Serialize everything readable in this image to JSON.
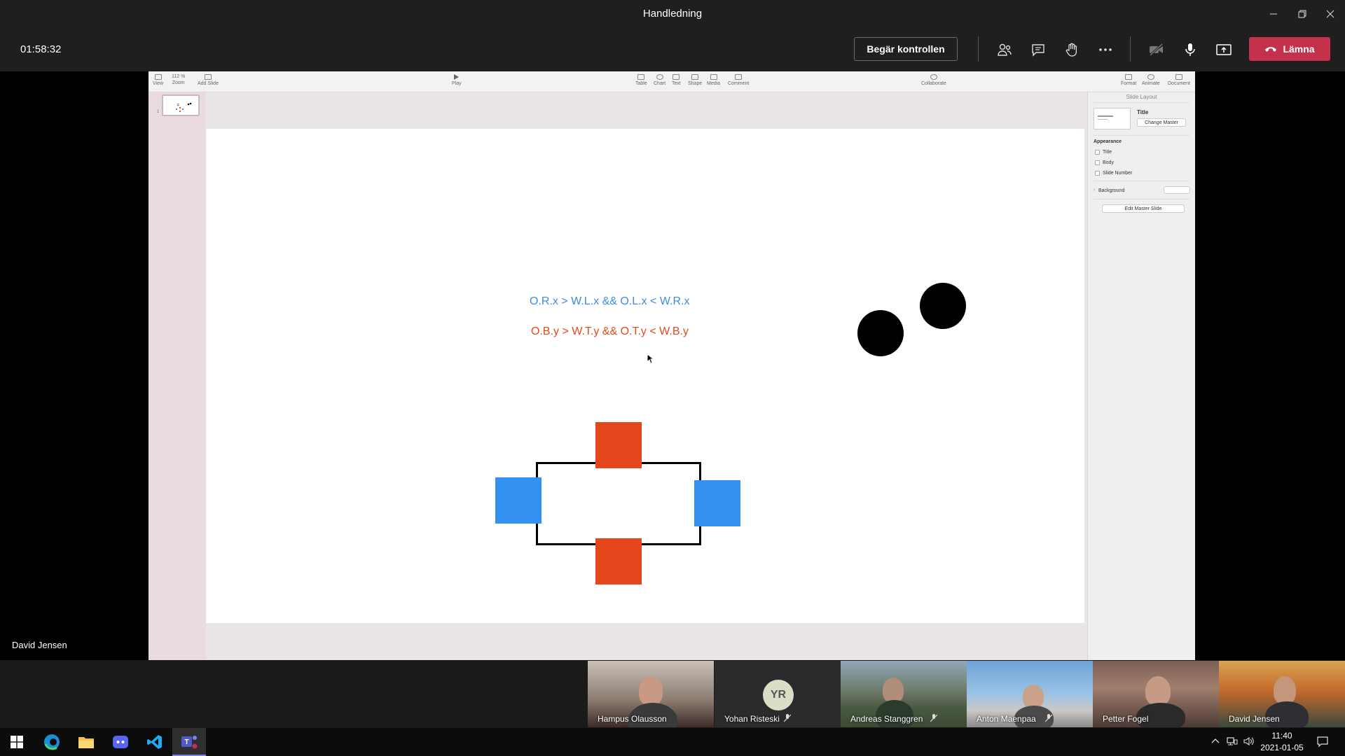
{
  "window": {
    "title": "Handledning",
    "controls": [
      "minimize-icon",
      "restore-icon",
      "close-icon"
    ]
  },
  "meeting_toolbar": {
    "duration": "01:58:32",
    "request_control_label": "Begär kontrollen",
    "icons": [
      "participants-icon",
      "chat-icon",
      "raise-hand-icon",
      "more-icon",
      "camera-off-icon",
      "microphone-icon",
      "share-screen-icon"
    ],
    "leave_label": "Lämna",
    "leave_color": "#c4314b"
  },
  "keynote": {
    "toolbar": {
      "zoom_value": "112 %",
      "items_left": [
        "View",
        "Zoom",
        "Add Slide"
      ],
      "play_label": "Play",
      "items_insert": [
        "Table",
        "Chart",
        "Text",
        "Shape",
        "Media",
        "Comment"
      ],
      "collaborate_label": "Collaborate",
      "items_right": [
        "Format",
        "Animate",
        "Document"
      ]
    },
    "slide_number": "1",
    "slide": {
      "formula_x": "O.R.x > W.L.x && O.L.x < W.R.x",
      "formula_y": "O.B.y > W.T.y && O.T.y < W.B.y",
      "formula_x_color": "#3a8ee6",
      "formula_y_color": "#e04a1c",
      "red_color": "#e5461b",
      "blue_color": "#3391f0"
    },
    "inspector": {
      "header": "Slide Layout",
      "layout_name": "Title",
      "change_master_label": "Change Master",
      "appearance_label": "Appearance",
      "options": [
        "Title",
        "Body",
        "Slide Number"
      ],
      "background_label": "Background",
      "edit_master_label": "Edit Master Slide"
    }
  },
  "presenter_name": "David Jensen",
  "participants": [
    {
      "name": "Hampus Olausson",
      "muted": false
    },
    {
      "name": "Yohan Risteski",
      "initials": "YR",
      "muted": true
    },
    {
      "name": "Andreas Stanggren",
      "muted": true
    },
    {
      "name": "Anton Maenpaa",
      "muted": true
    },
    {
      "name": "Petter Fogel",
      "muted": false
    },
    {
      "name": "David Jensen",
      "muted": false
    }
  ],
  "taskbar": {
    "apps": [
      "windows-start-icon",
      "edge-icon",
      "file-explorer-icon",
      "discord-icon",
      "vscode-icon",
      "teams-icon"
    ],
    "time": "11:40",
    "date": "2021-01-05"
  }
}
